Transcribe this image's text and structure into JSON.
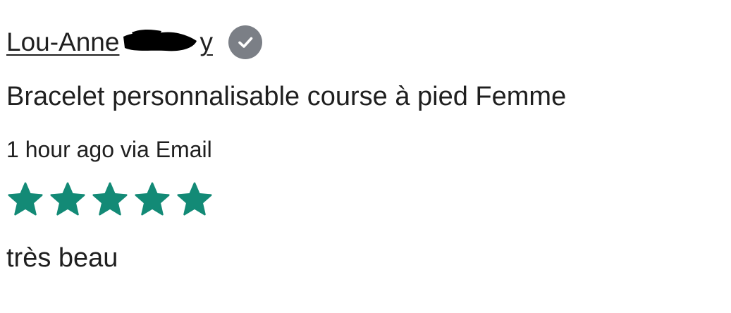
{
  "review": {
    "reviewer_name": "Lou-Anne",
    "reviewer_name_tail": "y",
    "verified_icon": "check-circle-icon",
    "product_title": "Bracelet personnalisable course à pied Femme",
    "meta": "1 hour ago via Email",
    "rating": 5,
    "rating_max": 5,
    "star_color": "#138a76",
    "body": "très beau"
  }
}
